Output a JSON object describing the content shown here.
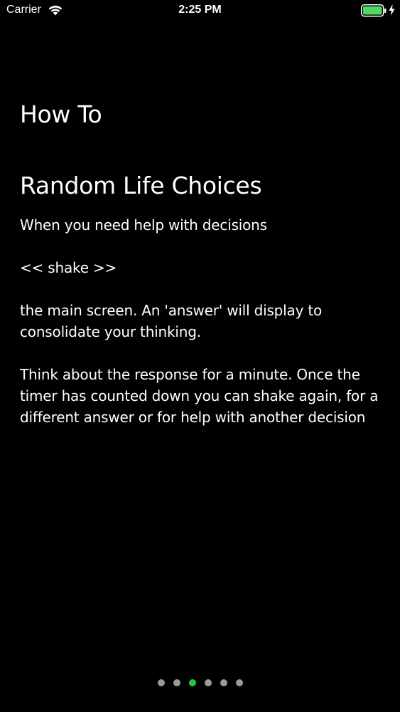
{
  "status_bar": {
    "carrier": "Carrier",
    "time": "2:25 PM",
    "wifi_icon": "wifi-icon",
    "battery_icon": "battery-icon",
    "charging_icon": "charging-bolt-icon",
    "battery_color": "#4cd964"
  },
  "page": {
    "heading": "How To",
    "app_title": "Random Life Choices",
    "paragraphs": [
      "When you need help with decisions",
      "<< shake >>",
      "the main screen. An 'answer' will display to consolidate your thinking.",
      "Think about the response for a minute. Once the timer has counted down you can shake again, for a different answer or for help with another decision"
    ]
  },
  "page_control": {
    "total": 6,
    "current": 3,
    "active_color": "#27c93f",
    "inactive_color": "#9a9a9a"
  }
}
